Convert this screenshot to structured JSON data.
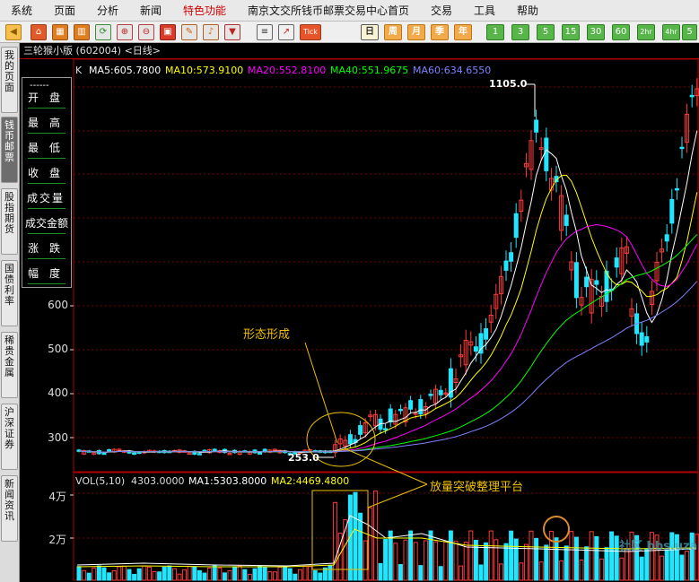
{
  "menu": [
    "系统",
    "页面",
    "分析",
    "新闻",
    "特色功能",
    "南京文交所钱币邮票交易中心首页",
    "交易",
    "工具",
    "帮助"
  ],
  "toolbar": {
    "periods": [
      "日",
      "周",
      "月",
      "季",
      "年"
    ],
    "minutes": [
      "1",
      "3",
      "5",
      "15",
      "30",
      "60",
      "2hr",
      "4hr",
      "5"
    ],
    "tick_label": "Tick"
  },
  "sidebar_tabs": [
    "我的页面",
    "钱币邮票",
    "股指期货",
    "国债利率",
    "稀贵金属",
    "沪深证券",
    "新闻资讯"
  ],
  "chart": {
    "title": "三轮猴小版 (602004) <日线>",
    "k_label": "K",
    "ma": [
      {
        "text": "MA5:605.7800",
        "color": "#ffffff"
      },
      {
        "text": "MA10:573.9100",
        "color": "#ffff00"
      },
      {
        "text": "MA20:552.8100",
        "color": "#ff00ff"
      },
      {
        "text": "MA40:551.9675",
        "color": "#00ff00"
      },
      {
        "text": "MA60:634.6550",
        "color": "#8080ff"
      }
    ],
    "price_ticks": [
      "600",
      "500",
      "400",
      "300"
    ],
    "high_label": "1105.0",
    "low_label": "253.0",
    "annotation_form": "形态形成",
    "annotation_volume": "放量突破整理平台",
    "watermark": "社区 bbs.uzai.com"
  },
  "info_panel": {
    "rows": [
      "开盘",
      "最高",
      "最低",
      "收盘",
      "成交量",
      "成交金额",
      "涨跌",
      "幅度"
    ],
    "dash": "------"
  },
  "volume": {
    "label": "VOL(5,10)",
    "value": "4303.0000",
    "ma1": "MA1:5303.8000",
    "ma2": "MA2:4469.4800",
    "ticks": [
      "4万",
      "2万"
    ]
  },
  "colors": {
    "up": "#ff3b3b",
    "down": "#20e6ff",
    "ma5": "#ffffff",
    "ma10": "#ffff00",
    "ma20": "#ff00ff",
    "ma40": "#00ff00",
    "ma60": "#8080ff",
    "annotation": "#f0c000"
  }
}
